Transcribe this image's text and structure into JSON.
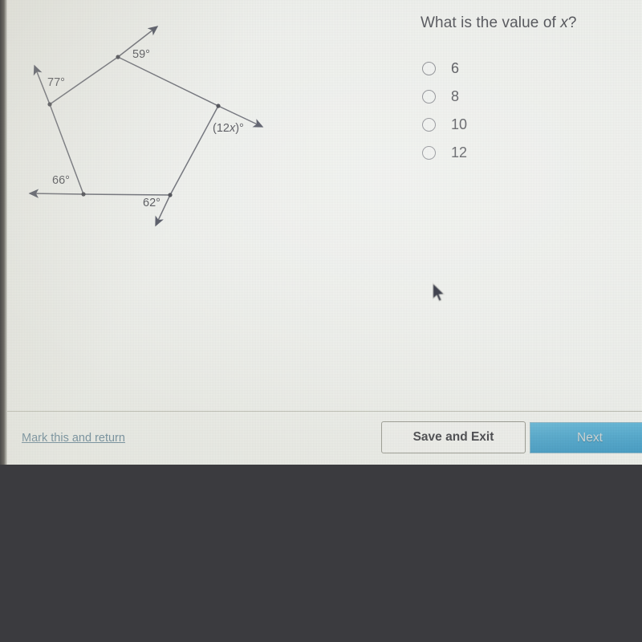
{
  "question": {
    "text_before": "What is the value of ",
    "variable": "x",
    "text_after": "?"
  },
  "answers": [
    {
      "value": "6",
      "selected": false
    },
    {
      "value": "8",
      "selected": false
    },
    {
      "value": "10",
      "selected": false
    },
    {
      "value": "12",
      "selected": false
    }
  ],
  "figure": {
    "type": "polygon-exterior-angles",
    "shape": "pentagon",
    "labels": {
      "top": "59°",
      "upper_left": "77°",
      "lower_left": "66°",
      "bottom": "62°",
      "right_prefix": "(12",
      "right_variable": "x",
      "right_suffix": ")°"
    }
  },
  "footer": {
    "mark_return_label": "Mark this and return",
    "save_exit_label": "Save and Exit",
    "next_label": "Next"
  },
  "colors": {
    "page_background": "#eef0ec",
    "desktop_background": "#3b3b3f",
    "link": "#5d7f93",
    "next_button": "#4fa7cd",
    "figure_stroke": "#4a4b55",
    "text": "#3f4046"
  }
}
